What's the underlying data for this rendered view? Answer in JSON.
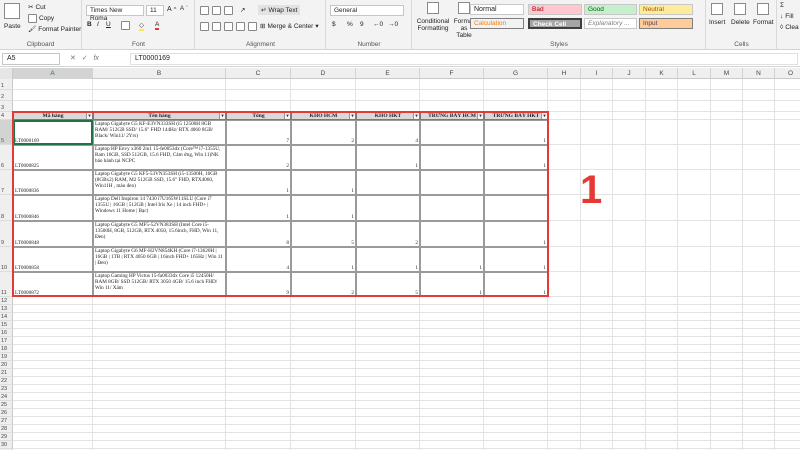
{
  "ribbon": {
    "clipboard": {
      "paste": "Paste",
      "cut": "Cut",
      "copy": "Copy",
      "format_painter": "Format Painter",
      "label": "Clipboard"
    },
    "font": {
      "family": "Times New Roma",
      "size": "11",
      "label": "Font"
    },
    "alignment": {
      "wrap_text": "Wrap Text",
      "merge": "Merge & Center",
      "label": "Alignment"
    },
    "number": {
      "format": "General",
      "currency": "$",
      "percent": "%",
      "comma": "9",
      "label": "Number"
    },
    "styles": {
      "conditional": "Conditional Formatting",
      "format_table": "Format as Table",
      "normal": "Normal",
      "bad": "Bad",
      "good": "Good",
      "neutral": "Neutral",
      "calculation": "Calculation",
      "check_cell": "Check Cell",
      "explanatory": "Explanatory ...",
      "input": "Input",
      "label": "Styles"
    },
    "cells": {
      "insert": "Insert",
      "delete": "Delete",
      "format": "Format",
      "label": "Cells"
    },
    "editing": {
      "fill": "Fill",
      "clear": "Clea"
    }
  },
  "formula_bar": {
    "name_box": "A5",
    "fx": "fx",
    "formula": "LT0000169"
  },
  "columns": [
    "A",
    "B",
    "C",
    "D",
    "E",
    "F",
    "G",
    "H",
    "I",
    "J",
    "K",
    "L",
    "M",
    "N",
    "O",
    "P"
  ],
  "rows": [
    "1",
    "2",
    "3",
    "4",
    "5",
    "6",
    "7",
    "8",
    "9",
    "10",
    "11",
    "12",
    "13",
    "14",
    "15",
    "16",
    "17",
    "18",
    "19",
    "20",
    "21",
    "22",
    "23",
    "24",
    "25",
    "26",
    "27",
    "28",
    "29",
    "30"
  ],
  "table": {
    "headers": [
      "Mã hàng",
      "Tên hàng",
      "Tổng",
      "KHO HCM",
      "KHO HKT",
      "TRƯNG BÀY HCM",
      "TRƯNG BÀY HKT"
    ],
    "filter_icon": "▾",
    "rows": [
      {
        "code": "LT0000169",
        "name": "Laptop Gigabyte G5 KF-E3VN333SH (i5 12500H 8GB RAM/ 512GB SSD/ 15.6\" FHD 144Hz/ RTX 4060 8GB/ Black/ Win11/ 2Yrs)",
        "total": "7",
        "kho_hcm": "2",
        "kho_hkt": "4",
        "tb_hcm": "",
        "tb_hkt": "1"
      },
      {
        "code": "LT0000825",
        "name": "Laptop HP Envy x360 2in1 15-fe0053dx (Core™ i7-1355U, Ram 16GB, SSD 512GB, 15.6 FHD, Cảm ứng, Win 11)NK bảo hành tại NCPC",
        "total": "2",
        "kho_hcm": "",
        "kho_hkt": "1",
        "tb_hcm": "",
        "tb_hkt": "1"
      },
      {
        "code": "LT0000836",
        "name": "Laptop Gigabyte G5 KF5-53VN353SH (i5-13500H, 16GB (8GBx2) RAM, M2 512GB SSD, 15.6\" FHD, RTX4060, Win11H , màu đen)",
        "total": "1",
        "kho_hcm": "1",
        "kho_hkt": "",
        "tb_hcm": "",
        "tb_hkt": ""
      },
      {
        "code": "LT0000846",
        "name": "Laptop Dell Inspiron 14 7430 i7U165W11SLU (Core i7 1355U | 16GB | 512GB | Intel Iris Xe | 14 inch FHD+ | Windows 11 Home | Bạc)",
        "total": "1",
        "kho_hcm": "1",
        "kho_hkt": "",
        "tb_hcm": "",
        "tb_hkt": ""
      },
      {
        "code": "LT0000848",
        "name": "Laptop Gigabyte G5 MF5-52VN383SH (Intel Core i5-13500H, 8GB, 512GB, RTX 4050, 15.6inch, FHD, Win 11, Đen)",
        "total": "8",
        "kho_hcm": "5",
        "kho_hkt": "2",
        "tb_hcm": "",
        "tb_hkt": "1"
      },
      {
        "code": "LT0000858",
        "name": "Laptop Gigabyte G6 MF-H2VN854KH (Core i7-13620H | 16GB | 1TB | RTX 4050 6GB | 16inch FHD+ 165Hz | Win 11 | Đen)",
        "total": "4",
        "kho_hcm": "1",
        "kho_hkt": "1",
        "tb_hcm": "1",
        "tb_hkt": "1"
      },
      {
        "code": "LT0000872",
        "name": "Laptop Gaming HP Victus 15-fa0033dx Core i5 12450H/ RAM 8GB/ SSD 512GB/ RTX 3050 4GB/ 15.6 inch FHD/ Win 11/ Xám",
        "total": "9",
        "kho_hcm": "2",
        "kho_hkt": "5",
        "tb_hcm": "1",
        "tb_hkt": "1"
      }
    ]
  },
  "callout": "1"
}
